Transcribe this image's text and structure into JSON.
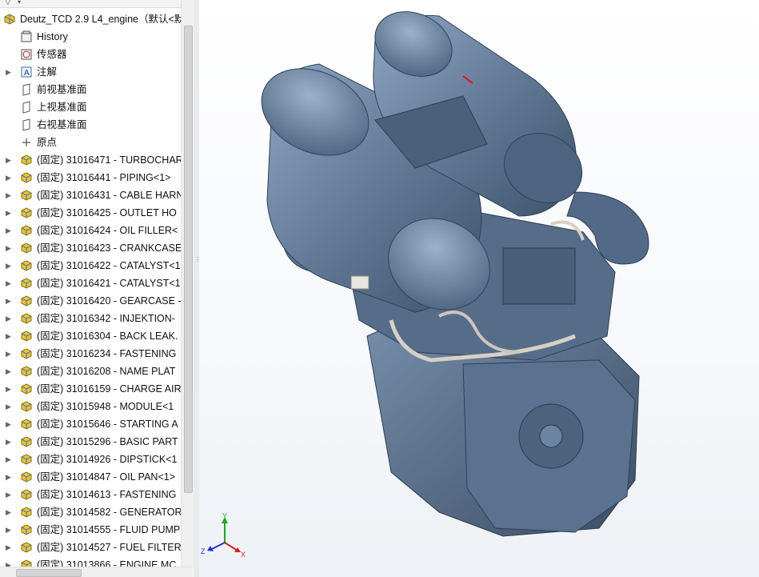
{
  "tree": {
    "root": "Deutz_TCD 2.9 L4_engine（默认<默",
    "fixed_items": [
      {
        "label": "History",
        "icon": "history-icon"
      },
      {
        "label": "传感器",
        "icon": "sensor-icon"
      },
      {
        "label": "注解",
        "icon": "annotation-icon"
      },
      {
        "label": "前视基准面",
        "icon": "plane-icon"
      },
      {
        "label": "上视基准面",
        "icon": "plane-icon"
      },
      {
        "label": "右视基准面",
        "icon": "plane-icon"
      },
      {
        "label": "原点",
        "icon": "origin-icon"
      }
    ],
    "parts": [
      "(固定) 31016471 - TURBOCHAR",
      "(固定) 31016441 - PIPING<1>",
      "(固定) 31016431 - CABLE HARN",
      "(固定) 31016425 - OUTLET HO",
      "(固定) 31016424 - OIL FILLER<",
      "(固定) 31016423 - CRANKCASE",
      "(固定) 31016422 - CATALYST<1",
      "(固定) 31016421 - CATALYST<1",
      "(固定) 31016420 - GEARCASE -",
      "(固定) 31016342 - INJEKTION-",
      "(固定) 31016304 - BACK LEAK.",
      "(固定) 31016234 - FASTENING",
      "(固定) 31016208 - NAME PLAT",
      "(固定) 31016159 - CHARGE AIR",
      "(固定) 31015948 - MODULE<1",
      "(固定) 31015646 - STARTING A",
      "(固定) 31015296 - BASIC PART",
      "(固定) 31014926 - DIPSTICK<1",
      "(固定) 31014847 - OIL PAN<1>",
      "(固定) 31014613 - FASTENING",
      "(固定) 31014582 - GENERATOR",
      "(固定) 31014555 - FLUID PUMP",
      "(固定) 31014527 - FUEL FILTER",
      "(固定) 31013866 - ENGINE MC"
    ]
  },
  "triad": {
    "x": "X",
    "y": "Y",
    "z": "Z"
  },
  "colors": {
    "engine": "#5b7390",
    "engine_dark": "#3f536c",
    "engine_light": "#8aa2bd",
    "pipe": "#d8cfc6",
    "marker": "#e01010"
  }
}
